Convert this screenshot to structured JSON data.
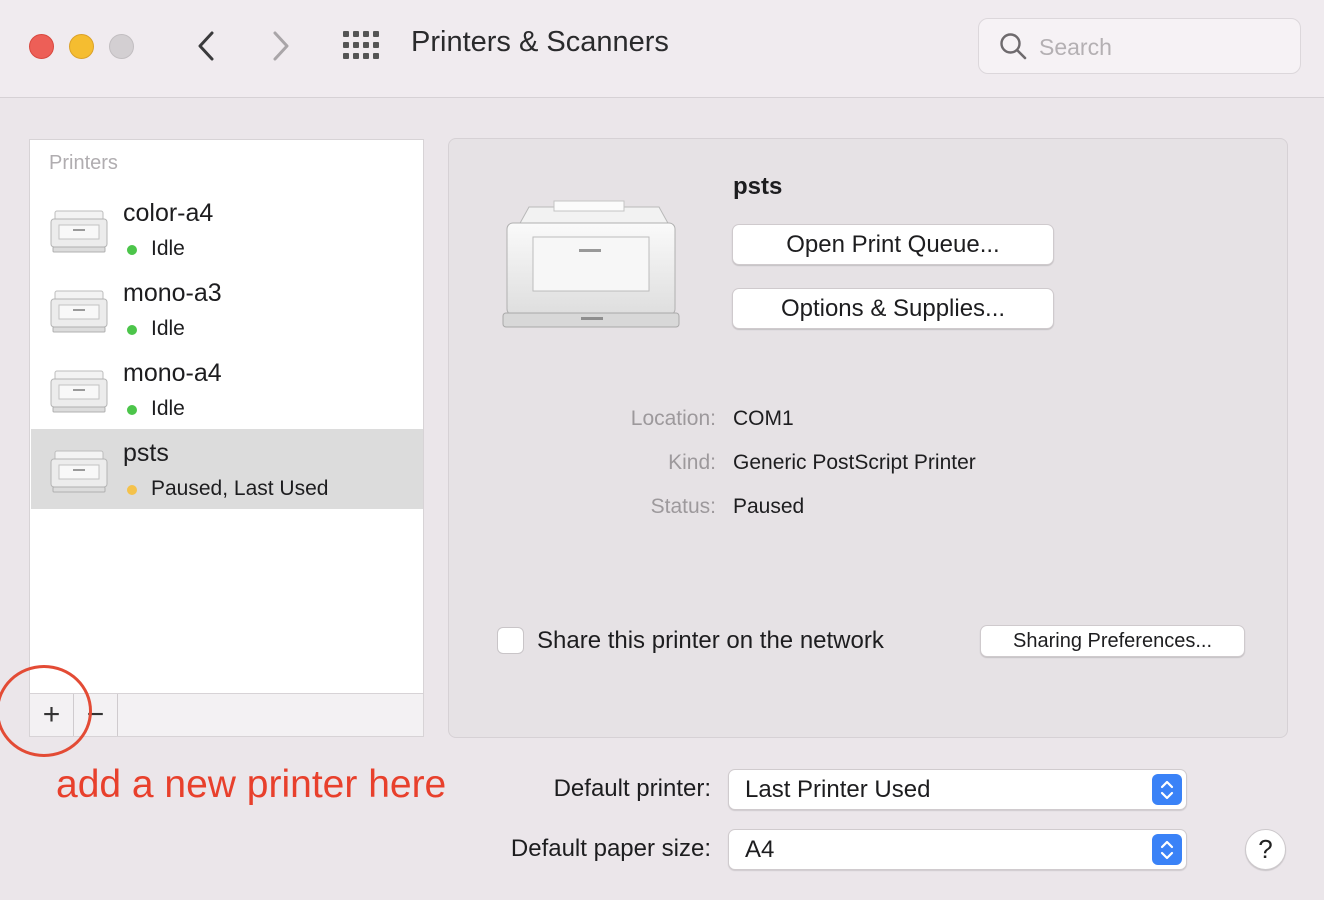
{
  "window": {
    "title": "Printers & Scanners",
    "search_placeholder": "Search"
  },
  "sidebar": {
    "header": "Printers",
    "items": [
      {
        "name": "color-a4",
        "status": "Idle",
        "status_color": "#4cc54a",
        "selected": false
      },
      {
        "name": "mono-a3",
        "status": "Idle",
        "status_color": "#4cc54a",
        "selected": false
      },
      {
        "name": "mono-a4",
        "status": "Idle",
        "status_color": "#4cc54a",
        "selected": false
      },
      {
        "name": "psts",
        "status": "Paused, Last Used",
        "status_color": "#f4c24b",
        "selected": true
      }
    ],
    "add_label": "+",
    "remove_label": "−"
  },
  "annotation": {
    "text": "add a new printer here",
    "color": "#e8402c"
  },
  "detail": {
    "name": "psts",
    "open_queue_label": "Open Print Queue...",
    "options_label": "Options & Supplies...",
    "location_label": "Location:",
    "location_value": "COM1",
    "kind_label": "Kind:",
    "kind_value": "Generic PostScript Printer",
    "status_label": "Status:",
    "status_value": "Paused",
    "share_label": "Share this printer on the network",
    "share_checked": false,
    "sharing_prefs_label": "Sharing Preferences..."
  },
  "bottom": {
    "default_printer_label": "Default printer:",
    "default_printer_value": "Last Printer Used",
    "paper_size_label": "Default paper size:",
    "paper_size_value": "A4",
    "help_label": "?"
  }
}
